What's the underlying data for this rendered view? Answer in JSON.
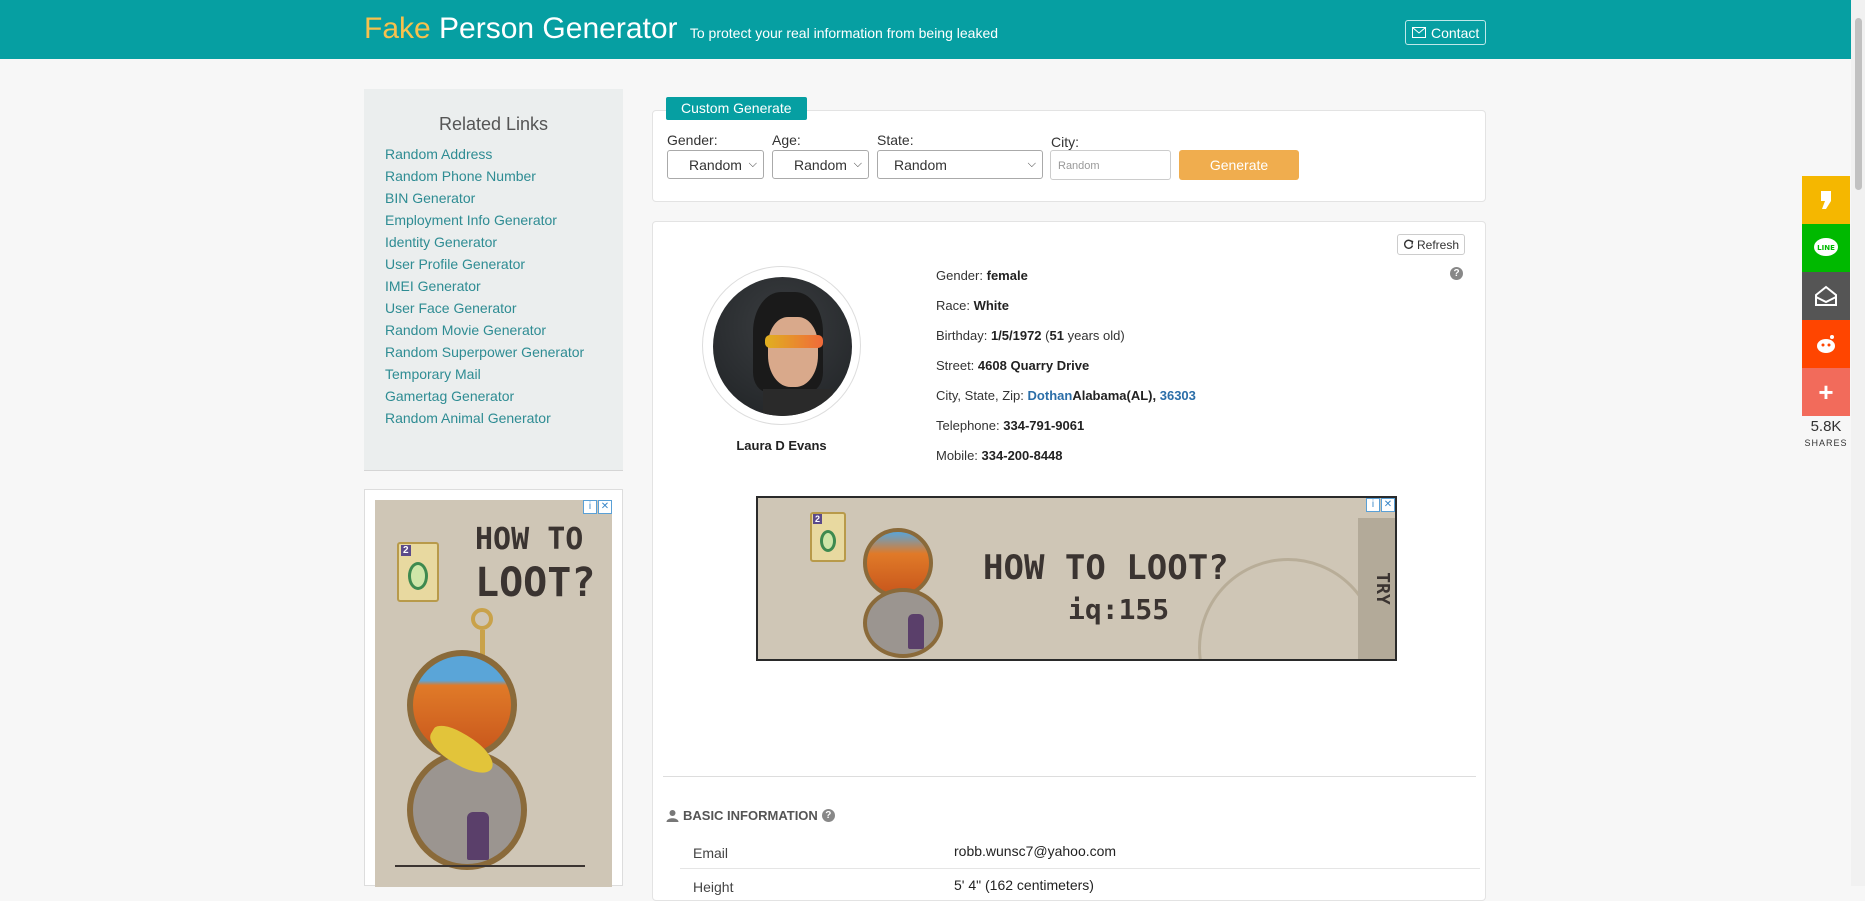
{
  "header": {
    "brand_fake": "Fake",
    "brand_rest": "Person Generator",
    "tagline": "To protect your real information from being leaked",
    "contact_label": "Contact"
  },
  "sidebar": {
    "title": "Related Links",
    "links": [
      "Random Address",
      "Random Phone Number",
      "BIN Generator",
      "Employment Info Generator",
      "Identity Generator",
      "User Profile Generator",
      "IMEI Generator",
      "User Face Generator",
      "Random Movie Generator",
      "Random Superpower Generator",
      "Temporary Mail",
      "Gamertag Generator",
      "Random Animal Generator"
    ]
  },
  "ads": {
    "side_title_1": "HOW TO",
    "side_title_2": "LOOT?",
    "main_title": "HOW TO LOOT?",
    "main_sub": "iq:155",
    "main_try": "TRY",
    "card_number": "2",
    "adchoice_i": "i",
    "adchoice_x": "✕"
  },
  "form": {
    "tab_label": "Custom Generate",
    "gender_label": "Gender:",
    "gender_value": "Random",
    "age_label": "Age:",
    "age_value": "Random",
    "state_label": "State:",
    "state_value": "Random",
    "city_label": "City:",
    "city_placeholder": "Random",
    "generate_label": "Generate"
  },
  "profile": {
    "refresh_label": "Refresh",
    "name": "Laura D Evans",
    "gender_label": "Gender:",
    "gender": "female",
    "race_label": "Race:",
    "race": "White",
    "birthday_label": "Birthday:",
    "birthday": "1/5/1972",
    "age_open": "(",
    "age": "51",
    "age_suffix": "years old)",
    "street_label": "Street:",
    "street": "4608 Quarry Drive",
    "city_label": "City, State, Zip:",
    "city": "Dothan",
    "state": "Alabama(AL),",
    "zip": "36303",
    "telephone_label": "Telephone:",
    "telephone": "334-791-9061",
    "mobile_label": "Mobile:",
    "mobile": "334-200-8448"
  },
  "basic": {
    "heading": "BASIC INFORMATION",
    "email_label": "Email",
    "email": "robb.wunsc7@yahoo.com",
    "height_label": "Height",
    "height": "5' 4\" (162 centimeters)"
  },
  "share": {
    "count": "5.8K",
    "label": "SHARES",
    "colors": [
      "#f5b700",
      "#00b900",
      "#555555",
      "#ff4500",
      "#f26b5b"
    ]
  },
  "colors": {
    "brand": "#069fa2",
    "accent": "#f7c14d",
    "generate": "#f0ad4e"
  }
}
